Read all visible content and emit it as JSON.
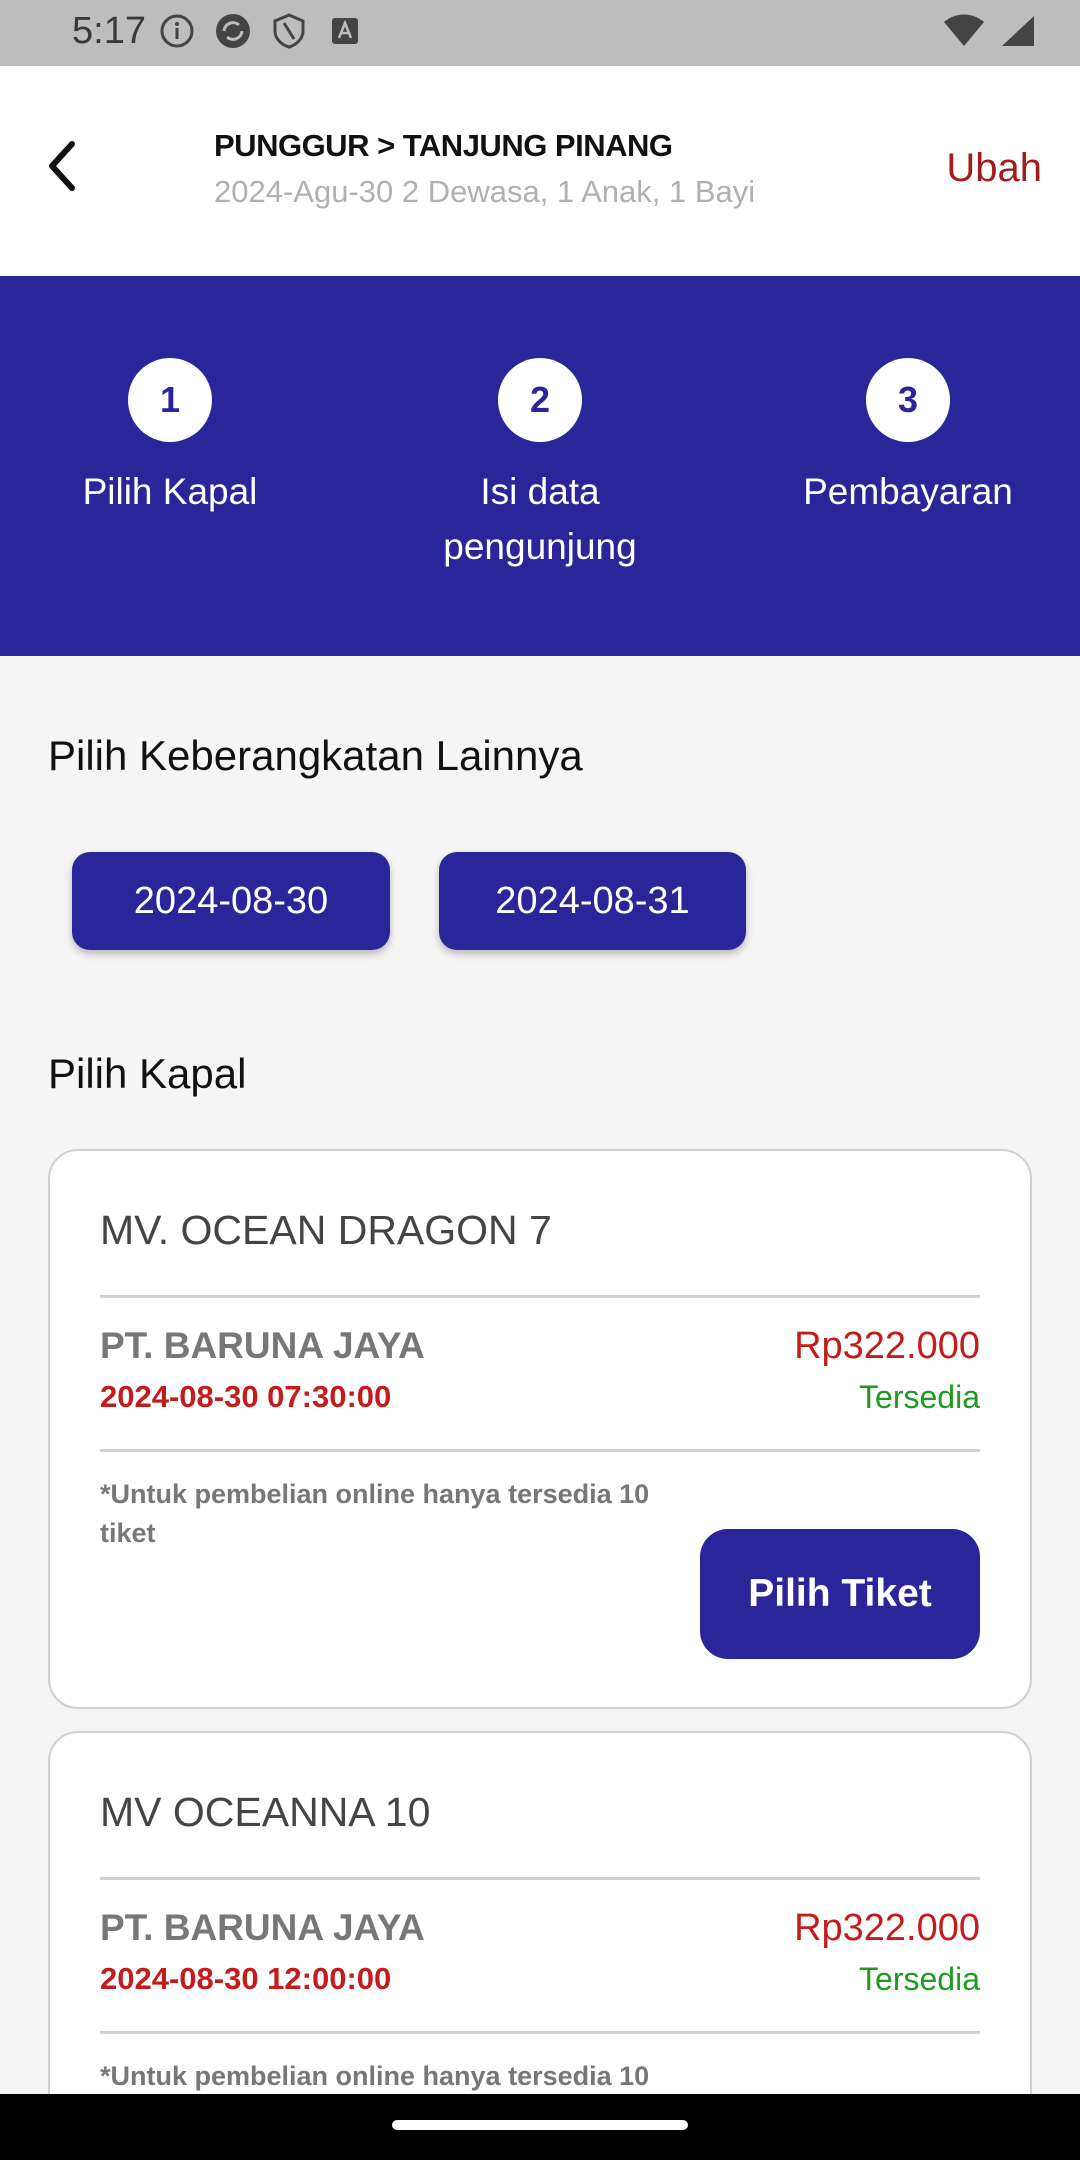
{
  "status_bar": {
    "time": "5:17"
  },
  "header": {
    "route": "PUNGGUR > TANJUNG PINANG",
    "details": "2024-Agu-30 2 Dewasa, 1 Anak, 1 Bayi",
    "edit_label": "Ubah"
  },
  "steps": [
    {
      "number": "1",
      "label": "Pilih Kapal"
    },
    {
      "number": "2",
      "label": "Isi data pengunjung"
    },
    {
      "number": "3",
      "label": "Pembayaran"
    }
  ],
  "other_departures": {
    "title": "Pilih Keberangkatan Lainnya",
    "dates": [
      "2024-08-30",
      "2024-08-31"
    ]
  },
  "ships_section": {
    "title": "Pilih Kapal",
    "ships": [
      {
        "name": "MV. OCEAN DRAGON 7",
        "operator": "PT. BARUNA JAYA",
        "departure": "2024-08-30 07:30:00",
        "price": "Rp322.000",
        "availability": "Tersedia",
        "note": "*Untuk pembelian online hanya tersedia 10 tiket",
        "button": "Pilih Tiket"
      },
      {
        "name": "MV OCEANNA 10",
        "operator": "PT. BARUNA JAYA",
        "departure": "2024-08-30 12:00:00",
        "price": "Rp322.000",
        "availability": "Tersedia",
        "note": "*Untuk pembelian online hanya tersedia 10"
      }
    ]
  },
  "colors": {
    "primary": "#2a2599",
    "accent_red": "#c41b1b",
    "available_green": "#1e9b1e"
  }
}
